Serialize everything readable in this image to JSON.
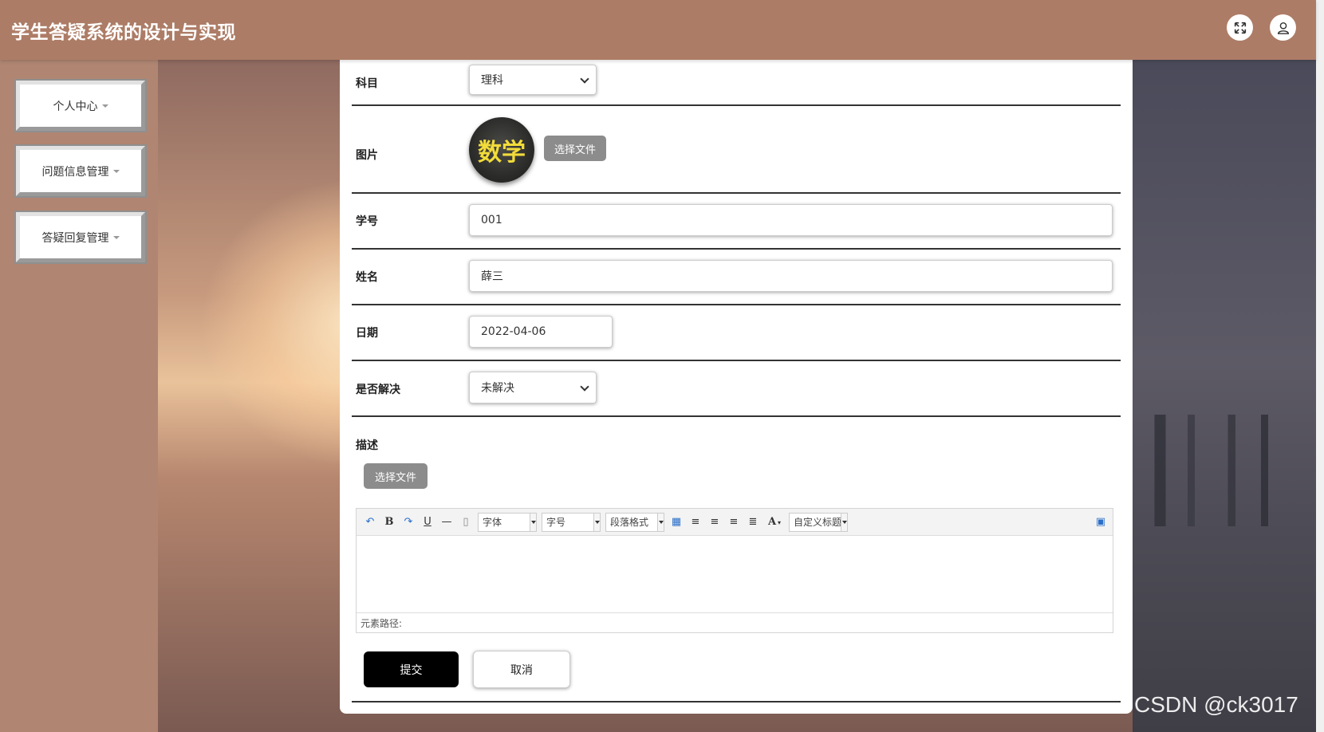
{
  "header": {
    "title": "学生答疑系统的设计与实现"
  },
  "sidebar": {
    "items": [
      {
        "label": "个人中心"
      },
      {
        "label": "问题信息管理"
      },
      {
        "label": "答疑回复管理"
      }
    ]
  },
  "form": {
    "subject": {
      "label": "科目",
      "value": "理科"
    },
    "image": {
      "label": "图片",
      "thumb_text": "数学",
      "choose_label": "选择文件"
    },
    "student_id": {
      "label": "学号",
      "value": "001"
    },
    "name": {
      "label": "姓名",
      "value": "薛三"
    },
    "date": {
      "label": "日期",
      "value": "2022-04-06"
    },
    "resolved": {
      "label": "是否解决",
      "value": "未解决"
    },
    "description": {
      "label": "描述",
      "choose_label": "选择文件"
    },
    "submit_label": "提交",
    "cancel_label": "取消"
  },
  "editor": {
    "font_label": "字体",
    "size_label": "字号",
    "paragraph_label": "段落格式",
    "custom_title_label": "自定义标题",
    "element_path_label": "元素路径:"
  },
  "watermark": "CSDN @ck3017"
}
